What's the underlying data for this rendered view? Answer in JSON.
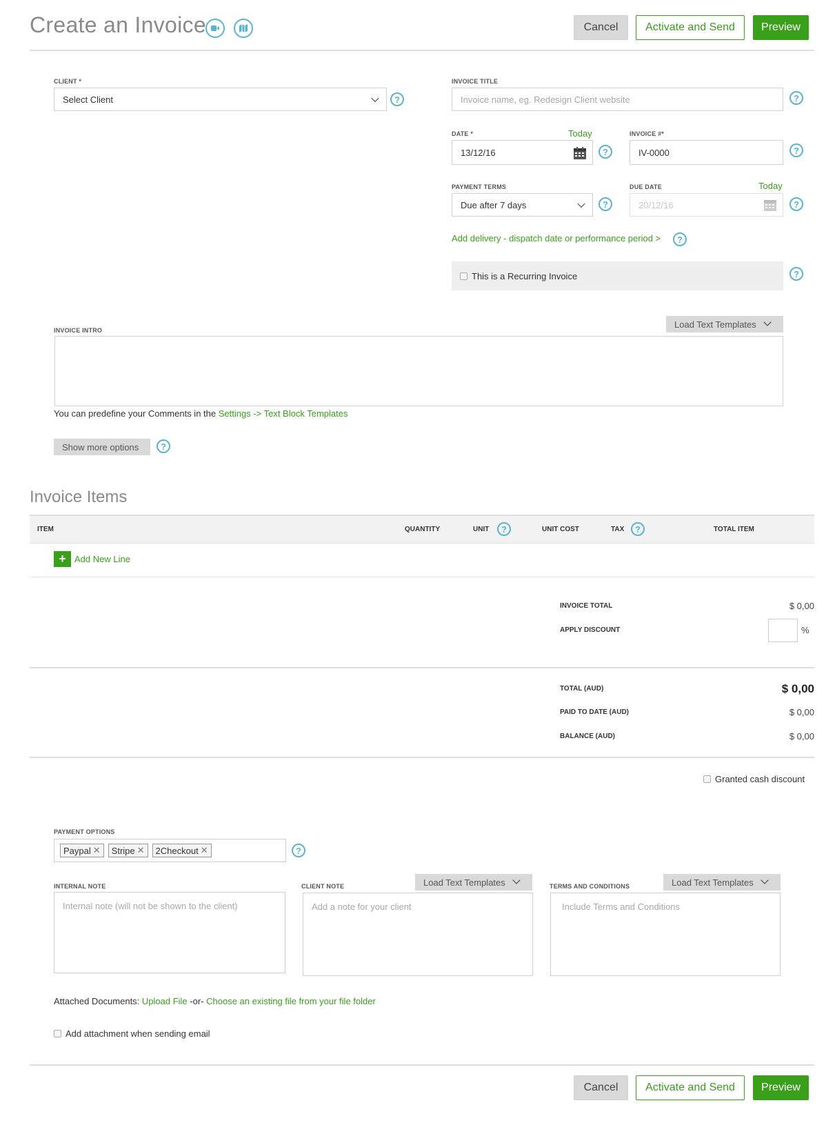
{
  "header": {
    "title": "Create an Invoice",
    "cancel_label": "Cancel",
    "activate_label": "Activate and Send",
    "preview_label": "Preview"
  },
  "form": {
    "client_label": "CLIENT *",
    "client_value": "Select Client",
    "invoice_title_label": "INVOICE TITLE",
    "invoice_title_placeholder": "Invoice name, eg. Redesign Client website",
    "date_label": "DATE *",
    "date_today": "Today",
    "date_value": "13/12/16",
    "invoice_no_label": "INVOICE #*",
    "invoice_no_value": "IV-0000",
    "payment_terms_label": "PAYMENT TERMS",
    "payment_terms_value": "Due after 7 days",
    "due_date_label": "DUE DATE",
    "due_date_today": "Today",
    "due_date_value": "20/12/16",
    "delivery_link": "Add delivery - dispatch date or performance period >",
    "recurring_label": "This is a Recurring Invoice",
    "intro_label": "INVOICE INTRO",
    "load_templates": "Load Text Templates",
    "predefine_text": "You can predefine your Comments in the ",
    "predefine_link": "Settings -> Text Block Templates",
    "show_more": "Show more options"
  },
  "items": {
    "heading": "Invoice Items",
    "columns": [
      "ITEM",
      "QUANTITY",
      "UNIT",
      "UNIT COST",
      "TAX",
      "TOTAL ITEM"
    ],
    "add_line": "Add New Line"
  },
  "summary": {
    "invoice_total_label": "INVOICE TOTAL",
    "invoice_total_value": "$ 0,00",
    "discount_label": "APPLY DISCOUNT",
    "discount_unit": "%",
    "total_label": "TOTAL (AUD)",
    "total_value": "$ 0,00",
    "paid_label": "PAID TO DATE (AUD)",
    "paid_value": "$ 0,00",
    "balance_label": "BALANCE (AUD)",
    "balance_value": "$ 0,00",
    "cash_discount_label": "Granted cash discount"
  },
  "payment": {
    "options_label": "PAYMENT OPTIONS",
    "options": [
      "Paypal",
      "Stripe",
      "2Checkout"
    ]
  },
  "notes": {
    "internal_label": "INTERNAL NOTE",
    "internal_placeholder": "Internal note (will not be shown to the client)",
    "client_label": "CLIENT NOTE",
    "client_placeholder": "Add a note for your client",
    "terms_label": "TERMS AND CONDITIONS",
    "terms_placeholder": "Include Terms and Conditions",
    "load_templates": "Load Text Templates"
  },
  "attachments": {
    "prefix": "Attached Documents: ",
    "upload": "Upload File",
    "or": " -or- ",
    "choose": "Choose an existing file from your file folder",
    "add_attachment_label": "Add attachment when sending email"
  },
  "footer": {
    "cancel_label": "Cancel",
    "activate_label": "Activate and Send",
    "preview_label": "Preview"
  },
  "colors": {
    "accent_green": "#3aa01c",
    "help_blue": "#5ab4cf",
    "title_gray": "#8a8a8a"
  }
}
